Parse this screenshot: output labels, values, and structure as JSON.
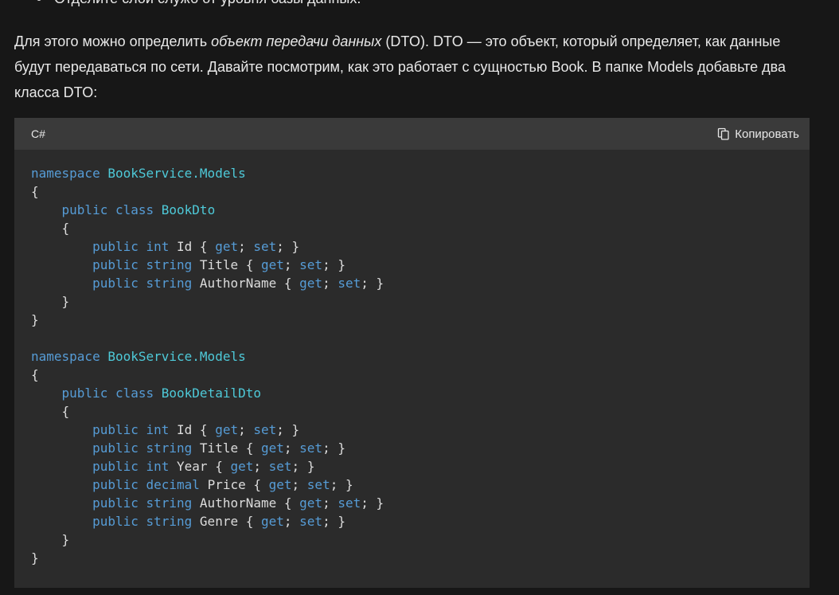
{
  "bullet": {
    "text": "Отделите слой служб от уровня базы данных."
  },
  "paragraph": {
    "part1": "Для этого можно определить ",
    "emphasis": "объект передачи данных",
    "part2": " (DTO). DTO — это объект, который определяет, как данные будут передаваться по сети. Давайте посмотрим, как это работает с сущностью Book. В папке Models добавьте два класса DTO:"
  },
  "code_block": {
    "language": "C#",
    "copy_label": "Копировать",
    "copy_icon": "copy-icon",
    "colors": {
      "keyword": "#569cd6",
      "type": "#4ec9d8",
      "plain": "#dcdcdc",
      "background": "#2b2b2b",
      "header": "#3a3a3a"
    },
    "lines": [
      [
        [
          "k",
          "namespace "
        ],
        [
          "t",
          "BookService.Models"
        ]
      ],
      [
        [
          "p",
          "{"
        ]
      ],
      [
        [
          "p",
          "    "
        ],
        [
          "k",
          "public class "
        ],
        [
          "t",
          "BookDto"
        ]
      ],
      [
        [
          "p",
          "    {"
        ]
      ],
      [
        [
          "p",
          "        "
        ],
        [
          "k",
          "public int "
        ],
        [
          "p",
          "Id { "
        ],
        [
          "k",
          "get"
        ],
        [
          "p",
          "; "
        ],
        [
          "k",
          "set"
        ],
        [
          "p",
          "; }"
        ]
      ],
      [
        [
          "p",
          "        "
        ],
        [
          "k",
          "public string "
        ],
        [
          "p",
          "Title { "
        ],
        [
          "k",
          "get"
        ],
        [
          "p",
          "; "
        ],
        [
          "k",
          "set"
        ],
        [
          "p",
          "; }"
        ]
      ],
      [
        [
          "p",
          "        "
        ],
        [
          "k",
          "public string "
        ],
        [
          "p",
          "AuthorName { "
        ],
        [
          "k",
          "get"
        ],
        [
          "p",
          "; "
        ],
        [
          "k",
          "set"
        ],
        [
          "p",
          "; }"
        ]
      ],
      [
        [
          "p",
          "    }"
        ]
      ],
      [
        [
          "p",
          "}"
        ]
      ],
      [
        [
          "p",
          ""
        ]
      ],
      [
        [
          "k",
          "namespace "
        ],
        [
          "t",
          "BookService.Models"
        ]
      ],
      [
        [
          "p",
          "{"
        ]
      ],
      [
        [
          "p",
          "    "
        ],
        [
          "k",
          "public class "
        ],
        [
          "t",
          "BookDetailDto"
        ]
      ],
      [
        [
          "p",
          "    {"
        ]
      ],
      [
        [
          "p",
          "        "
        ],
        [
          "k",
          "public int "
        ],
        [
          "p",
          "Id { "
        ],
        [
          "k",
          "get"
        ],
        [
          "p",
          "; "
        ],
        [
          "k",
          "set"
        ],
        [
          "p",
          "; }"
        ]
      ],
      [
        [
          "p",
          "        "
        ],
        [
          "k",
          "public string "
        ],
        [
          "p",
          "Title { "
        ],
        [
          "k",
          "get"
        ],
        [
          "p",
          "; "
        ],
        [
          "k",
          "set"
        ],
        [
          "p",
          "; }"
        ]
      ],
      [
        [
          "p",
          "        "
        ],
        [
          "k",
          "public int "
        ],
        [
          "p",
          "Year { "
        ],
        [
          "k",
          "get"
        ],
        [
          "p",
          "; "
        ],
        [
          "k",
          "set"
        ],
        [
          "p",
          "; }"
        ]
      ],
      [
        [
          "p",
          "        "
        ],
        [
          "k",
          "public decimal "
        ],
        [
          "p",
          "Price { "
        ],
        [
          "k",
          "get"
        ],
        [
          "p",
          "; "
        ],
        [
          "k",
          "set"
        ],
        [
          "p",
          "; }"
        ]
      ],
      [
        [
          "p",
          "        "
        ],
        [
          "k",
          "public string "
        ],
        [
          "p",
          "AuthorName { "
        ],
        [
          "k",
          "get"
        ],
        [
          "p",
          "; "
        ],
        [
          "k",
          "set"
        ],
        [
          "p",
          "; }"
        ]
      ],
      [
        [
          "p",
          "        "
        ],
        [
          "k",
          "public string "
        ],
        [
          "p",
          "Genre { "
        ],
        [
          "k",
          "get"
        ],
        [
          "p",
          "; "
        ],
        [
          "k",
          "set"
        ],
        [
          "p",
          "; }"
        ]
      ],
      [
        [
          "p",
          "    }"
        ]
      ],
      [
        [
          "p",
          "}"
        ]
      ]
    ]
  }
}
